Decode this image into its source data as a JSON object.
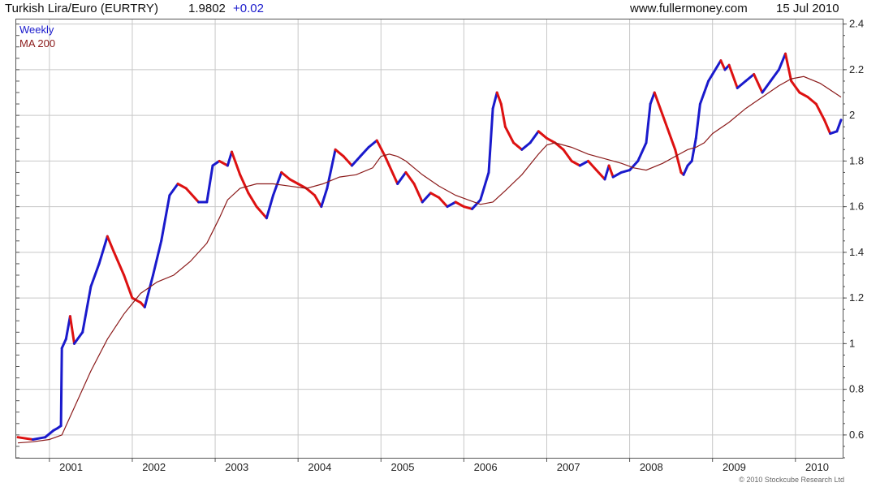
{
  "header": {
    "title": "Turkish Lira/Euro (EURTRY)",
    "price": "1.9802",
    "change": "+0.02",
    "site": "www.fullermoney.com",
    "date": "15 Jul 2010"
  },
  "footer": {
    "copyright": "© 2010 Stockcube Research Ltd"
  },
  "colors": {
    "up": "#1a1acc",
    "down": "#dd1111",
    "ma": "#8b1a1a",
    "grid": "#c8c8c8"
  },
  "chart_data": {
    "type": "line",
    "x_unit": "year",
    "xlim": [
      2000.6,
      2010.57
    ],
    "ylim": [
      0.5,
      2.42
    ],
    "x_ticks": [
      "2001",
      "2002",
      "2003",
      "2004",
      "2005",
      "2006",
      "2007",
      "2008",
      "2009",
      "2010"
    ],
    "y_ticks": [
      "0.6",
      "0.8",
      "1",
      "1.2",
      "1.4",
      "1.6",
      "1.8",
      "2",
      "2.2",
      "2.4"
    ],
    "grid": true,
    "legend": [
      "Weekly",
      "MA 200"
    ],
    "legend_position": "top-left",
    "series": [
      {
        "name": "Weekly",
        "style": "price bars, blue when rising, red when falling",
        "x": [
          2000.62,
          2000.8,
          2000.95,
          2001.05,
          2001.1,
          2001.14,
          2001.15,
          2001.2,
          2001.25,
          2001.3,
          2001.4,
          2001.5,
          2001.6,
          2001.7,
          2001.78,
          2001.9,
          2002.0,
          2002.1,
          2002.15,
          2002.25,
          2002.35,
          2002.45,
          2002.55,
          2002.65,
          2002.8,
          2002.9,
          2002.97,
          2003.05,
          2003.15,
          2003.2,
          2003.3,
          2003.4,
          2003.5,
          2003.62,
          2003.7,
          2003.8,
          2003.9,
          2004.0,
          2004.1,
          2004.2,
          2004.28,
          2004.35,
          2004.45,
          2004.55,
          2004.65,
          2004.75,
          2004.85,
          2004.95,
          2005.05,
          2005.1,
          2005.2,
          2005.3,
          2005.4,
          2005.5,
          2005.6,
          2005.7,
          2005.8,
          2005.9,
          2006.0,
          2006.1,
          2006.2,
          2006.3,
          2006.35,
          2006.4,
          2006.45,
          2006.5,
          2006.6,
          2006.7,
          2006.8,
          2006.9,
          2007.0,
          2007.1,
          2007.2,
          2007.3,
          2007.4,
          2007.5,
          2007.6,
          2007.7,
          2007.75,
          2007.8,
          2007.9,
          2008.0,
          2008.1,
          2008.2,
          2008.25,
          2008.3,
          2008.4,
          2008.5,
          2008.55,
          2008.62,
          2008.65,
          2008.7,
          2008.75,
          2008.8,
          2008.85,
          2008.9,
          2008.95,
          2009.0,
          2009.1,
          2009.15,
          2009.2,
          2009.3,
          2009.4,
          2009.5,
          2009.6,
          2009.7,
          2009.8,
          2009.88,
          2009.95,
          2010.05,
          2010.15,
          2010.25,
          2010.35,
          2010.42,
          2010.5,
          2010.55
        ],
        "y": [
          0.59,
          0.58,
          0.59,
          0.62,
          0.63,
          0.64,
          0.98,
          1.02,
          1.12,
          1.0,
          1.05,
          1.25,
          1.35,
          1.47,
          1.4,
          1.3,
          1.2,
          1.18,
          1.16,
          1.3,
          1.45,
          1.65,
          1.7,
          1.68,
          1.62,
          1.62,
          1.78,
          1.8,
          1.78,
          1.84,
          1.74,
          1.66,
          1.6,
          1.55,
          1.65,
          1.75,
          1.72,
          1.7,
          1.68,
          1.65,
          1.6,
          1.68,
          1.85,
          1.82,
          1.78,
          1.82,
          1.86,
          1.89,
          1.82,
          1.78,
          1.7,
          1.75,
          1.7,
          1.62,
          1.66,
          1.64,
          1.6,
          1.62,
          1.6,
          1.59,
          1.63,
          1.75,
          2.03,
          2.1,
          2.05,
          1.95,
          1.88,
          1.85,
          1.88,
          1.93,
          1.9,
          1.88,
          1.85,
          1.8,
          1.78,
          1.8,
          1.76,
          1.72,
          1.78,
          1.73,
          1.75,
          1.76,
          1.8,
          1.88,
          2.05,
          2.1,
          2.0,
          1.9,
          1.85,
          1.75,
          1.74,
          1.78,
          1.8,
          1.9,
          2.05,
          2.1,
          2.15,
          2.18,
          2.24,
          2.2,
          2.22,
          2.12,
          2.15,
          2.18,
          2.1,
          2.15,
          2.2,
          2.27,
          2.15,
          2.1,
          2.08,
          2.05,
          1.98,
          1.92,
          1.93,
          1.98
        ]
      },
      {
        "name": "MA 200",
        "style": "smooth dark red line",
        "x": [
          2000.62,
          2000.8,
          2001.0,
          2001.15,
          2001.3,
          2001.5,
          2001.7,
          2001.9,
          2002.1,
          2002.3,
          2002.5,
          2002.7,
          2002.9,
          2003.05,
          2003.15,
          2003.3,
          2003.5,
          2003.7,
          2003.9,
          2004.1,
          2004.3,
          2004.5,
          2004.7,
          2004.9,
          2005.0,
          2005.1,
          2005.2,
          2005.3,
          2005.5,
          2005.7,
          2005.9,
          2006.05,
          2006.2,
          2006.35,
          2006.5,
          2006.7,
          2006.9,
          2007.0,
          2007.1,
          2007.3,
          2007.5,
          2007.7,
          2007.9,
          2008.05,
          2008.2,
          2008.4,
          2008.6,
          2008.7,
          2008.8,
          2008.9,
          2009.0,
          2009.2,
          2009.4,
          2009.6,
          2009.8,
          2009.95,
          2010.1,
          2010.3,
          2010.55
        ],
        "y": [
          0.565,
          0.57,
          0.58,
          0.6,
          0.72,
          0.88,
          1.02,
          1.13,
          1.22,
          1.27,
          1.3,
          1.36,
          1.44,
          1.55,
          1.63,
          1.68,
          1.7,
          1.7,
          1.69,
          1.68,
          1.7,
          1.73,
          1.74,
          1.77,
          1.82,
          1.83,
          1.82,
          1.8,
          1.74,
          1.69,
          1.65,
          1.63,
          1.61,
          1.62,
          1.67,
          1.74,
          1.83,
          1.87,
          1.88,
          1.86,
          1.83,
          1.81,
          1.79,
          1.77,
          1.76,
          1.79,
          1.83,
          1.85,
          1.86,
          1.88,
          1.92,
          1.97,
          2.03,
          2.08,
          2.13,
          2.16,
          2.17,
          2.14,
          2.08
        ]
      }
    ]
  }
}
